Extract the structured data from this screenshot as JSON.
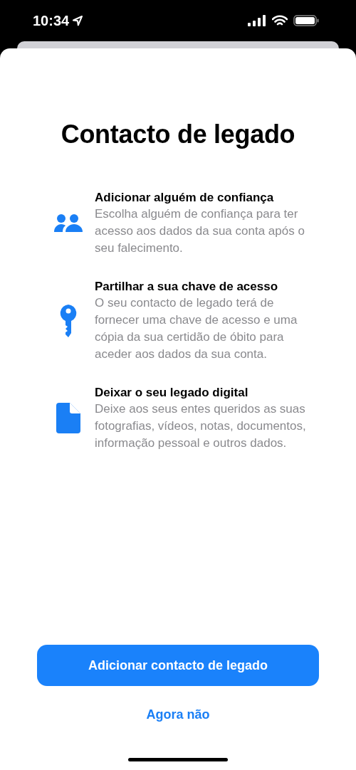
{
  "status_bar": {
    "time": "10:34"
  },
  "title": "Contacto de legado",
  "features": [
    {
      "kind": "people",
      "heading": "Adicionar alguém de confiança",
      "text": "Escolha alguém de confiança para ter acesso aos dados da sua conta após o seu falecimento."
    },
    {
      "kind": "key",
      "heading": "Partilhar a sua chave de acesso",
      "text": "O seu contacto de legado terá de fornecer uma chave de acesso e uma cópia da sua certidão de óbito para aceder aos dados da sua conta."
    },
    {
      "kind": "document",
      "heading": "Deixar o seu legado digital",
      "text": "Deixe aos seus entes queridos as suas fotografias, vídeos, notas, documentos, informação pessoal e outros dados."
    }
  ],
  "primary_button": "Adicionar contacto de legado",
  "secondary_button": "Agora não"
}
